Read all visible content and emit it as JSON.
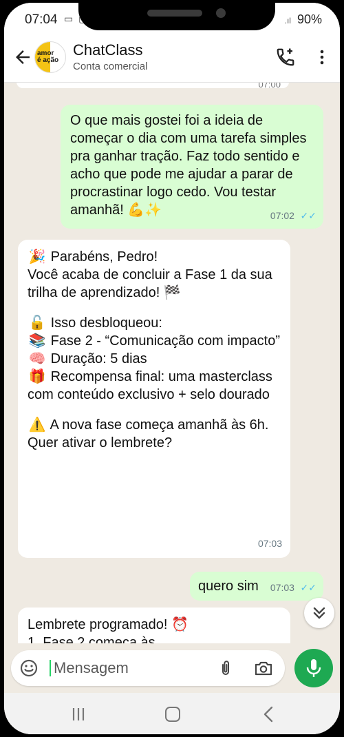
{
  "status": {
    "time": "07:04",
    "battery": "90%",
    "signal": ".ıl"
  },
  "header": {
    "contact_name": "ChatClass",
    "contact_subtitle": "Conta comercial",
    "avatar_text": "amor\né ação"
  },
  "messages": {
    "previous_time": "07:00",
    "outgoing_1": {
      "text": "O que mais gostei foi a ideia de começar o dia com uma tarefa simples pra ganhar tração. Faz todo sentido e acho que pode me ajudar a parar de procrastinar logo cedo. Vou testar amanhã! 💪✨",
      "time": "07:02",
      "ticks": "✓✓"
    },
    "incoming_1": {
      "line1": "Parabéns, Pedro!",
      "line2": "Você acaba de concluir a Fase 1 da sua trilha de aprendizado! 🏁",
      "unlocked": "Isso desbloqueou:",
      "phase": "Fase 2 - “Comunicação com impacto”",
      "duration": "Duração: 5 dias",
      "reward": "Recompensa final: uma masterclass com conteúdo exclusivo + selo dourado",
      "warning": "A nova fase começa amanhã às 6h. Quer ativar o lembrete?",
      "time": "07:03",
      "emojis": {
        "party": "🎉",
        "lock": "🔓",
        "books": "📚",
        "brain": "🧠",
        "gift": "🎁",
        "warning": "⚠️"
      }
    },
    "outgoing_2": {
      "text": "quero sim",
      "time": "07:03",
      "ticks": "✓✓"
    },
    "incoming_2": {
      "text": "Lembrete programado! ⏰",
      "partial_line": "1. Fase 2 começa às..."
    }
  },
  "composer": {
    "placeholder": "Mensagem"
  },
  "colors": {
    "outgoing_bubble": "#d9fdd3",
    "incoming_bubble": "#ffffff",
    "chat_background": "#efeae2",
    "accent_green": "#1ea952",
    "read_ticks": "#53bdeb"
  },
  "icons": [
    "back-arrow-icon",
    "add-call-icon",
    "more-options-icon",
    "chevrons-down-icon",
    "emoji-icon",
    "paperclip-icon",
    "camera-icon",
    "microphone-icon",
    "recent-apps-icon",
    "home-icon",
    "nav-back-icon"
  ]
}
